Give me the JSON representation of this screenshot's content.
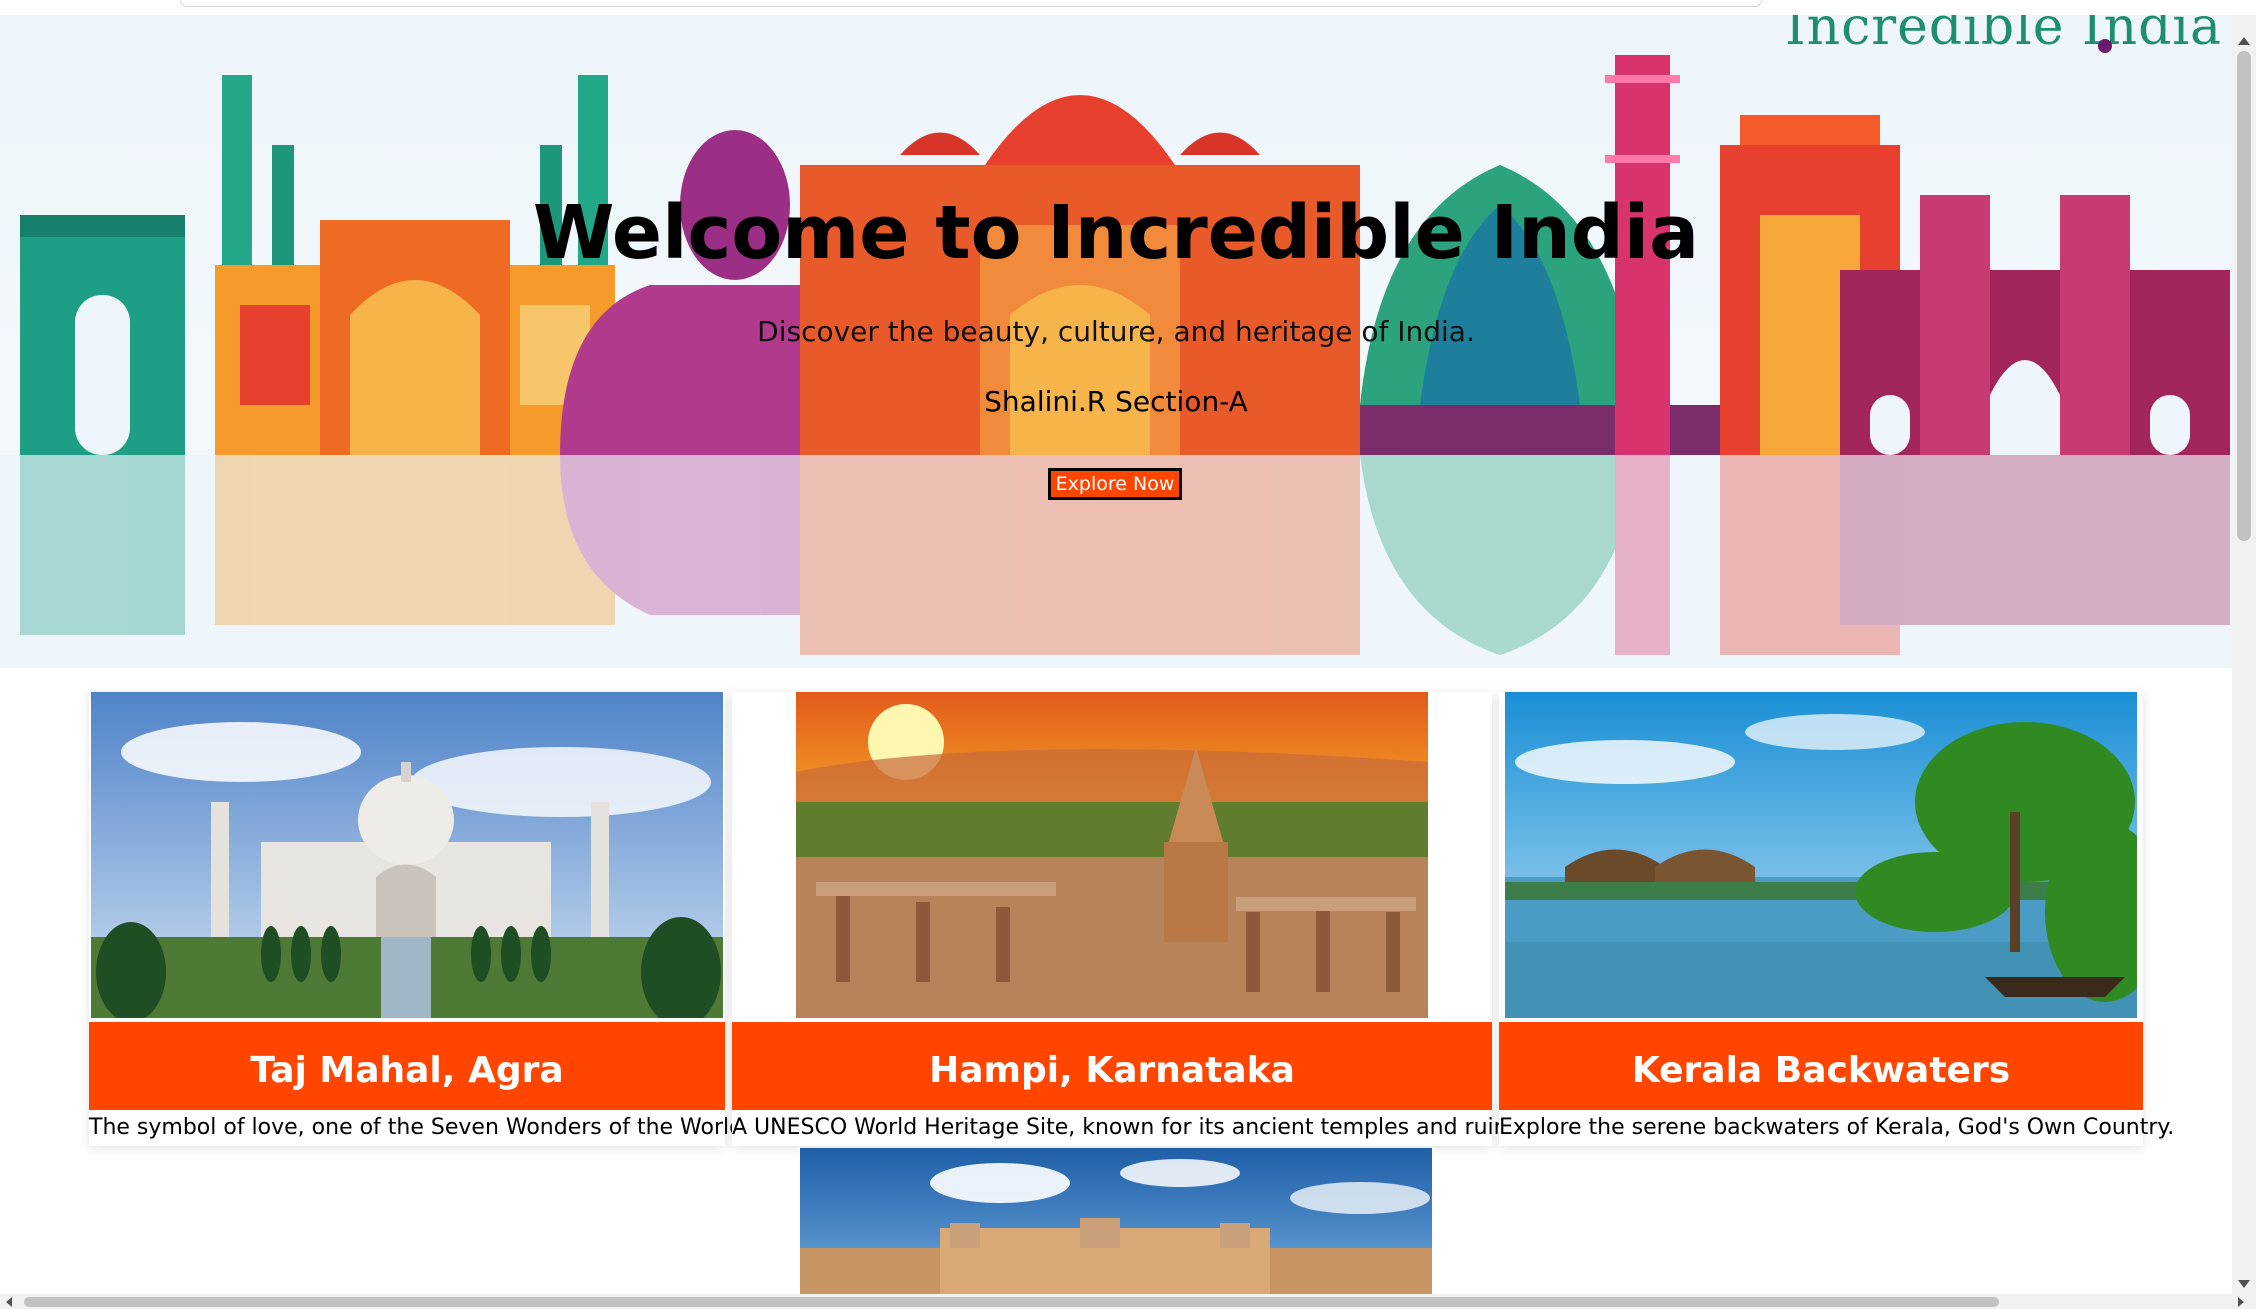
{
  "hero": {
    "brand": "Incredible India",
    "title": "Welcome to Incredible India",
    "subtitle": "Discover the beauty, culture, and heritage of India.",
    "author": "Shalini.R Section-A",
    "cta_label": "Explore Now"
  },
  "cards": [
    {
      "title": "Taj Mahal, Agra",
      "description": "The symbol of love, one of the Seven Wonders of the World."
    },
    {
      "title": "Hampi, Karnataka",
      "description": "A UNESCO World Heritage Site, known for its ancient temples and ruins."
    },
    {
      "title": "Kerala Backwaters",
      "description": "Explore the serene backwaters of Kerala, God's Own Country."
    }
  ],
  "colors": {
    "accent": "#ff4500",
    "text": "#000000",
    "background": "#ffffff"
  }
}
